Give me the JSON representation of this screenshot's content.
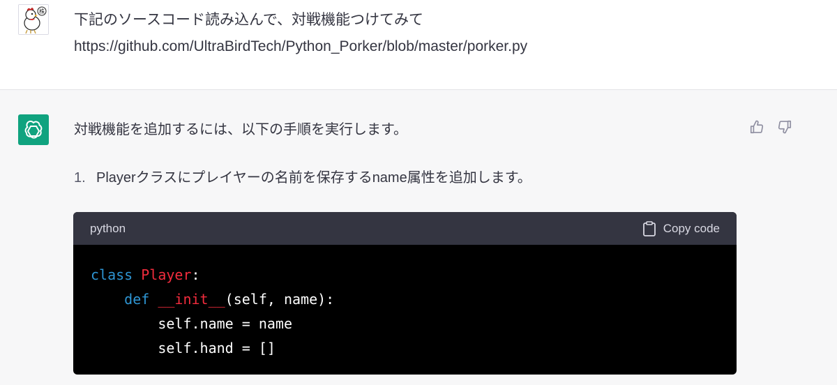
{
  "user_message": {
    "line1": "下記のソースコード読み込んで、対戦機能つけてみて",
    "line2": "https://github.com/UltraBirdTech/Python_Porker/blob/master/porker.py"
  },
  "assistant_message": {
    "intro": "対戦機能を追加するには、以下の手順を実行します。",
    "steps": [
      {
        "number": "1.",
        "text": "Playerクラスにプレイヤーの名前を保存するname属性を追加します。"
      }
    ],
    "code_block": {
      "language": "python",
      "copy_label": "Copy code",
      "lines": [
        {
          "indent": "",
          "t1": "class",
          "t2": " ",
          "t3": "Player",
          "t4": ":"
        },
        {
          "indent": "    ",
          "t1": "def",
          "t2": " ",
          "t3": "__init__",
          "t4": "(self, name):"
        },
        {
          "indent": "        ",
          "text": "self.name = name"
        },
        {
          "indent": "        ",
          "text": "self.hand = []"
        }
      ]
    }
  },
  "colors": {
    "assistant_bg": "#f7f7f8",
    "code_header_bg": "#343541",
    "code_bg": "#000000",
    "keyword": "#2e95d3",
    "class_name": "#f22c3d",
    "bot_avatar": "#10a37f"
  },
  "icons": [
    "user-avatar-chicken",
    "openai-logo-icon",
    "thumbs-up-icon",
    "thumbs-down-icon",
    "clipboard-icon"
  ]
}
